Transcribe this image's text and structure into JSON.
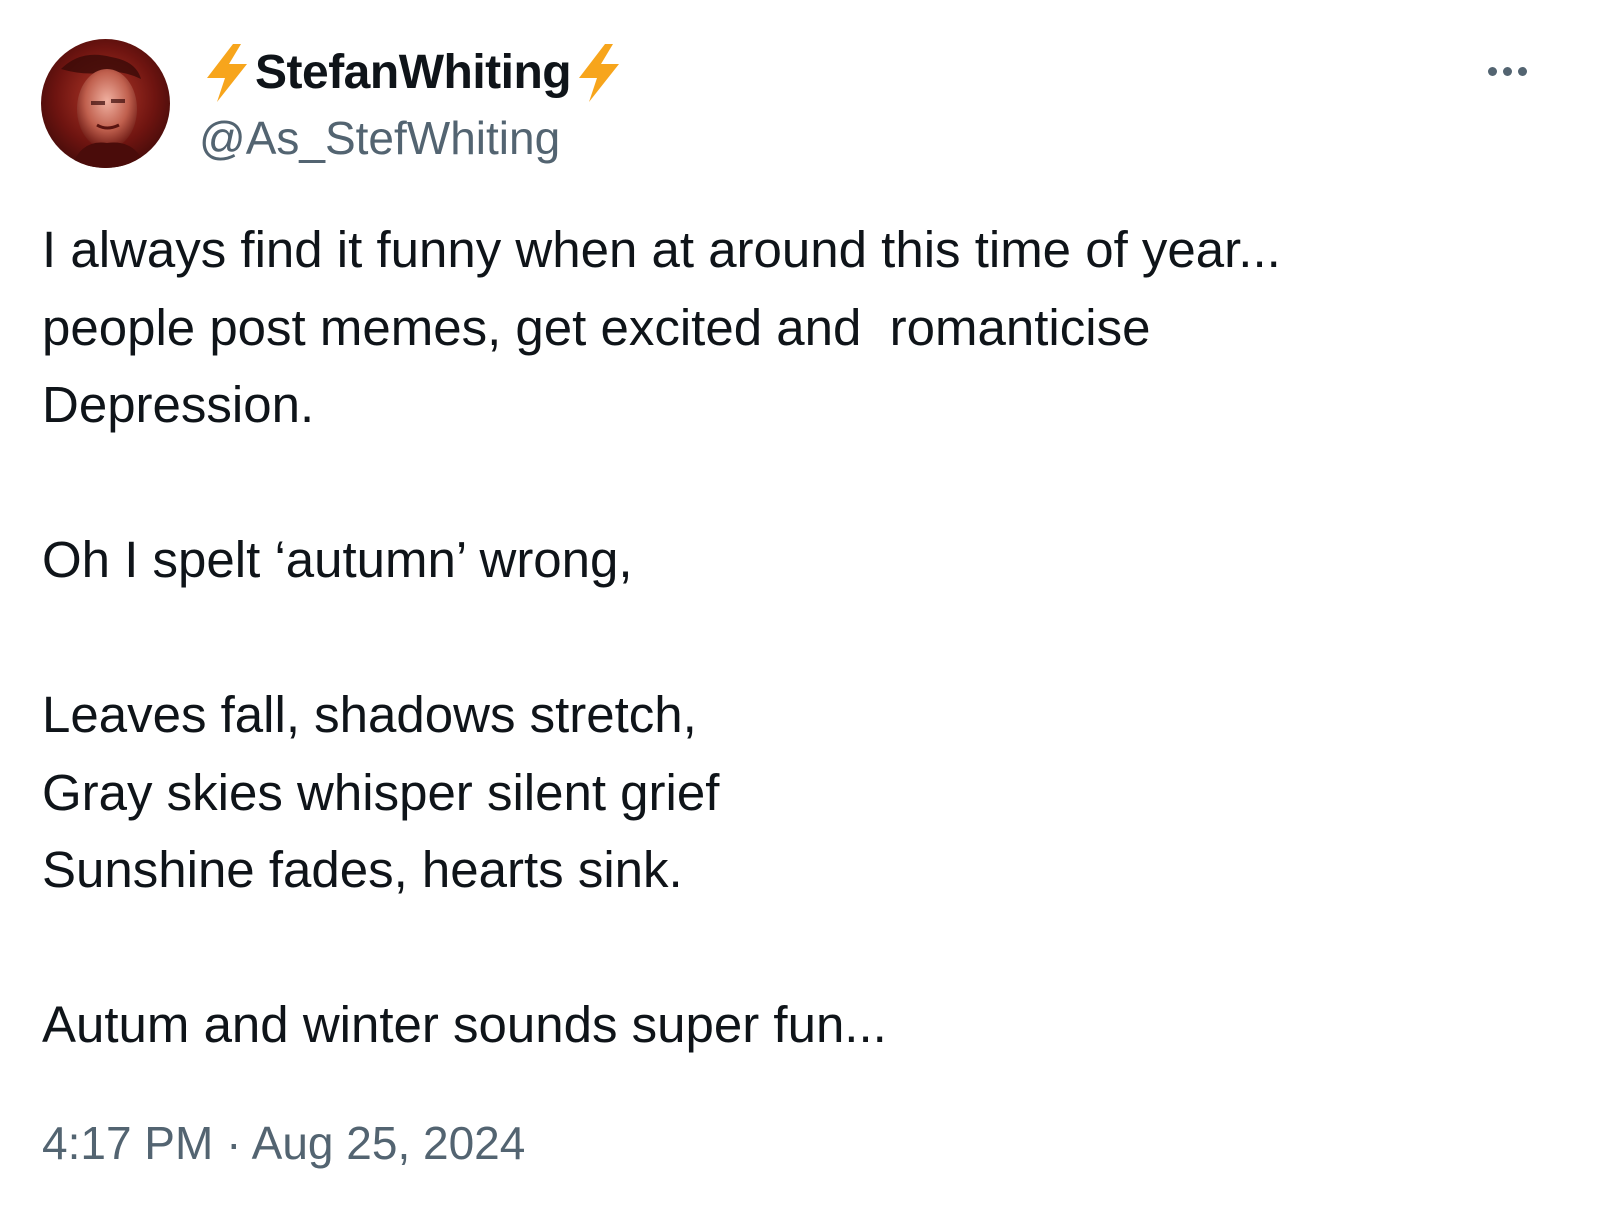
{
  "author": {
    "display_name": "StefanWhiting",
    "handle": "@As_StefWhiting",
    "name_emoji": "high-voltage-icon"
  },
  "tweet": {
    "lines": [
      "I always find it funny when at around this time of year...",
      "people post memes, get excited and  romanticise",
      "Depression.",
      "",
      "Oh I spelt ‘autumn’ wrong,",
      "",
      "Leaves fall, shadows stretch,",
      "Gray skies whisper silent grief",
      "Sunshine fades, hearts sink.",
      "",
      "Autum and winter sounds super fun..."
    ],
    "timestamp": "4:17 PM · Aug 25, 2024"
  },
  "colors": {
    "text_primary": "#0f1419",
    "text_secondary": "#536471",
    "bolt": "#f7a51c",
    "avatar_bg": "#5a0f0f"
  },
  "icons": {
    "more": "more-horizontal-icon"
  }
}
